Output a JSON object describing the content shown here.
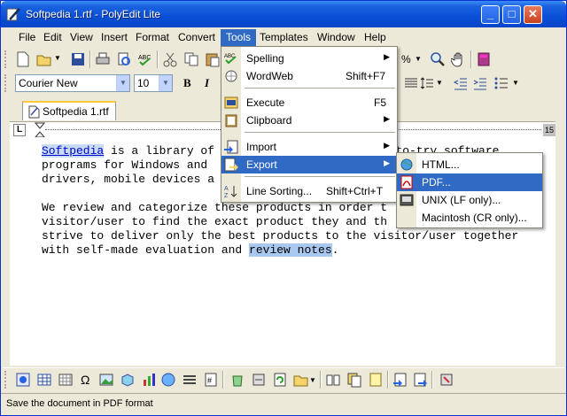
{
  "window": {
    "title": "Softpedia 1.rtf - PolyEdit Lite"
  },
  "menubar": {
    "items": [
      "File",
      "Edit",
      "View",
      "Insert",
      "Format",
      "Convert",
      "Tools",
      "Templates",
      "Window",
      "Help"
    ],
    "active": "Tools"
  },
  "toolbar": {
    "font_name": "Courier New",
    "font_size": "10",
    "zoom_suffix": "%"
  },
  "document": {
    "tab_label": "Softpedia 1.rtf",
    "ruler": {
      "tab_marker": "L",
      "end_marker": "15"
    },
    "paragraph1": {
      "link": "Softpedia",
      "line1_rest": " is a library of",
      "line1_tail": "ee-to-try software",
      "line2": "programs for Windows and ",
      "line3": "drivers, mobile devices a"
    },
    "paragraph2": {
      "line1a": "We review and categorize these products in order t",
      "line2a": "visitor/user to find the exact product they and th",
      "line3": "strive to deliver only the best products to the visitor/user together",
      "line4_pre": "with self-made evaluation and ",
      "line4_hl": "review notes",
      "line4_post": "."
    }
  },
  "tools_menu": {
    "items": [
      {
        "label": "Spelling",
        "shortcut": "",
        "submenu": true,
        "icon": "spelling-icon"
      },
      {
        "label": "WordWeb",
        "shortcut": "Shift+F7",
        "submenu": false,
        "icon": "wordweb-icon"
      },
      {
        "label": "Execute",
        "shortcut": "F5",
        "submenu": false,
        "icon": "execute-icon"
      },
      {
        "label": "Clipboard",
        "shortcut": "",
        "submenu": true,
        "icon": "clipboard-icon"
      },
      {
        "label": "Import",
        "shortcut": "",
        "submenu": true,
        "icon": "import-icon"
      },
      {
        "label": "Export",
        "shortcut": "",
        "submenu": true,
        "icon": "export-icon"
      },
      {
        "label": "Line Sorting...",
        "shortcut": "Shift+Ctrl+T",
        "submenu": false,
        "icon": "sort-icon"
      }
    ],
    "selected": "Export"
  },
  "export_menu": {
    "items": [
      {
        "label": "HTML...",
        "icon": "globe-icon"
      },
      {
        "label": "PDF...",
        "icon": "pdf-icon"
      },
      {
        "label": "UNIX (LF only)...",
        "icon": "unix-icon"
      },
      {
        "label": "Macintosh (CR only)...",
        "icon": ""
      }
    ],
    "selected": "PDF..."
  },
  "status": {
    "text": "Save the document in PDF format"
  },
  "colors": {
    "titlebar": "#0a4fd6",
    "menu_highlight": "#316ac5",
    "link": "#0000cc",
    "selection": "#a9c8ef"
  }
}
